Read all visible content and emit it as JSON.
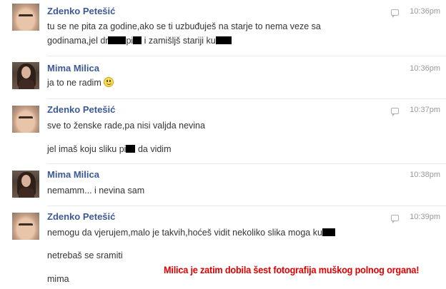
{
  "messages": [
    {
      "sender": "Zdenko Petešić",
      "time": "10:36pm",
      "lines": [
        [
          "tu se ne pita za godine,ako se ti uzbuđuješ na starje to nema veze sa"
        ],
        [
          "godinama,jel dr",
          "[censored]",
          "pi",
          "[censored]",
          " i zamišljš stariji ku",
          "[censored]"
        ]
      ]
    },
    {
      "sender": "Mima Milica",
      "time": "10:36pm",
      "text": "ja to ne radim",
      "emoticon": "smile-emoticon"
    },
    {
      "sender": "Zdenko Petešić",
      "time": "10:37pm",
      "line1": "sve to ženske rade,pa nisi valjda nevina",
      "line2a": "jel imaš koju sliku pi",
      "line2b": " da vidim"
    },
    {
      "sender": "Mima Milica",
      "time": "10:38pm",
      "text": "nemamm... i nevina sam"
    },
    {
      "sender": "Zdenko Petešić",
      "time": "10:39pm",
      "line1": "nemogu da vjerujem,malo je takvih,hoćeš vidit nekoliko slika moga ku",
      "line2": "netrebaš se sramiti",
      "line3": "mima"
    }
  ],
  "m0": {
    "l2a": "godinama,jel dr",
    "l2b": "pi",
    "l2c": " i zamišljš stariji ku"
  },
  "caption": "Milica je zatim dobila šest fotografija muškog polnog organa!",
  "colors": {
    "sender": "#3b5998",
    "caption": "#e00000",
    "text": "#333333",
    "time": "#999999"
  },
  "icons": [
    "reply-icon",
    "avatar-zdenko",
    "avatar-mima",
    "smile-emoticon"
  ]
}
